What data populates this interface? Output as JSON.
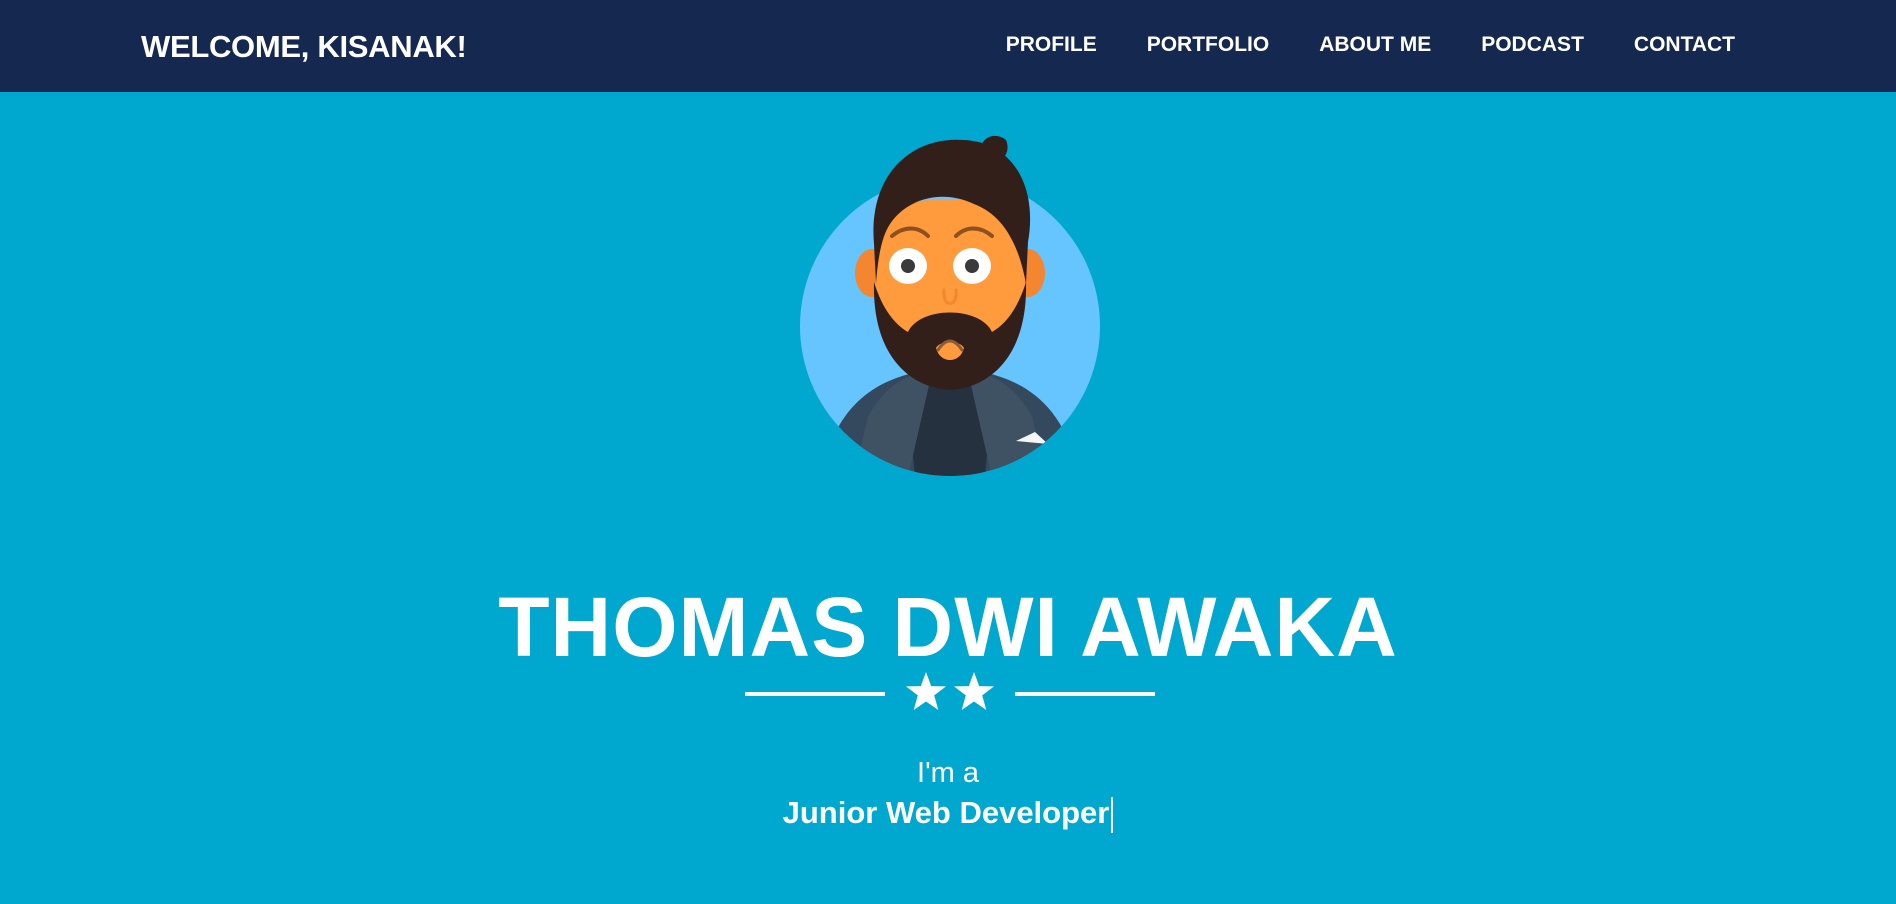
{
  "header": {
    "welcome_text": "WELCOME, KISANAK!"
  },
  "nav": {
    "items": [
      {
        "label": "PROFILE"
      },
      {
        "label": "PORTFOLIO"
      },
      {
        "label": "ABOUT ME"
      },
      {
        "label": "PODCAST"
      },
      {
        "label": "CONTACT"
      }
    ]
  },
  "hero": {
    "name": "THOMAS DWI AWAKA",
    "intro": "I'm a",
    "role": "Junior Web Developer"
  },
  "colors": {
    "navbar": "#152850",
    "background": "#00a8cf",
    "avatar_circle": "#66c5ff",
    "skin": "#ff9a3d",
    "hair": "#331f1a",
    "jacket": "#34495e"
  },
  "icons": {
    "avatar": "avatar-illustration",
    "divider": "star-icon"
  }
}
